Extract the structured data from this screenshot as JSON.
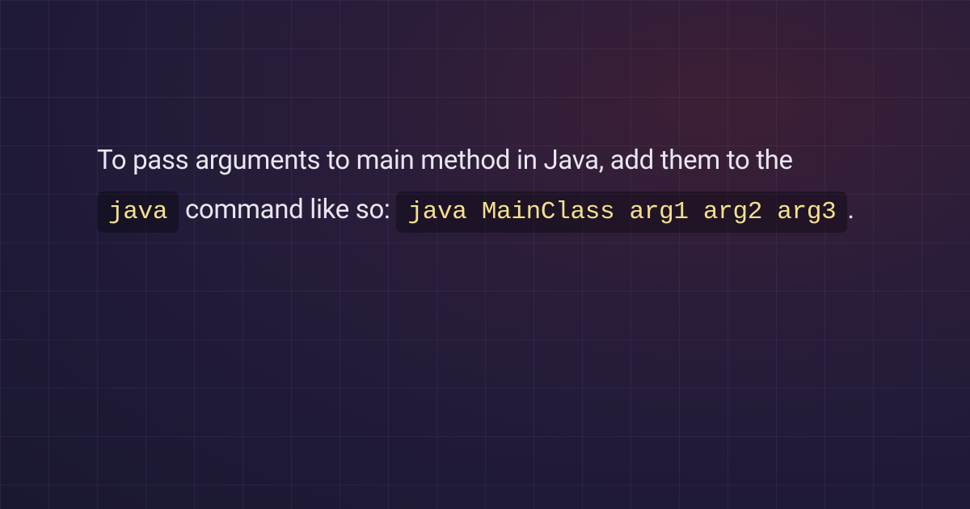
{
  "content": {
    "text1": "To pass arguments to main method in Java, add them to the ",
    "code1": "java",
    "text2": " command like so: ",
    "code2": "java MainClass arg1 arg2 arg3",
    "text3": "."
  }
}
